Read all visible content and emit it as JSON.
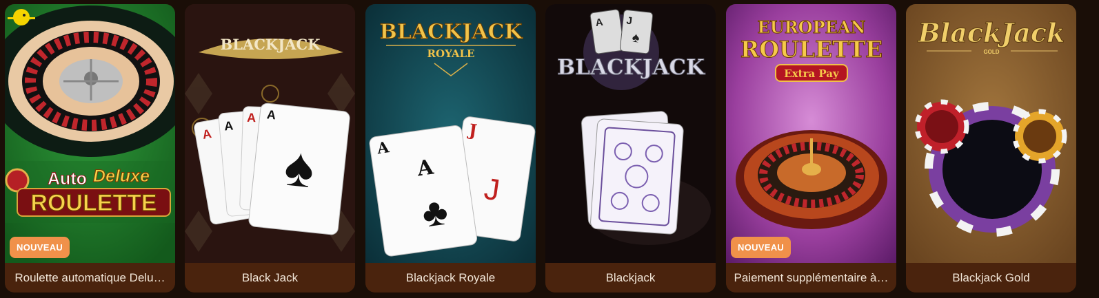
{
  "games": [
    {
      "caption": "Roulette automatique Delu…",
      "badge": "NOUVEAU",
      "logo_line1": "Auto",
      "logo_line1b": "Deluxe",
      "logo_line2": "ROULETTE"
    },
    {
      "caption": "Black Jack",
      "logo": "BLACKJACK"
    },
    {
      "caption": "Blackjack Royale",
      "logo_line1": "BLACKJACK",
      "logo_line2": "ROYALE"
    },
    {
      "caption": "Blackjack",
      "logo": "BLACKJACK"
    },
    {
      "caption": "Paiement supplémentaire à…",
      "badge": "NOUVEAU",
      "logo_line1": "EUROPEAN",
      "logo_line2": "ROULETTE",
      "logo_line3": "Extra Pay"
    },
    {
      "caption": "Blackjack Gold",
      "logo_line1": "BlackJack",
      "logo_line2": "GOLD"
    }
  ],
  "colors": {
    "page_bg": "#1a0e07",
    "caption_bg": "#4a230d",
    "badge_bg": "#f0914a"
  }
}
